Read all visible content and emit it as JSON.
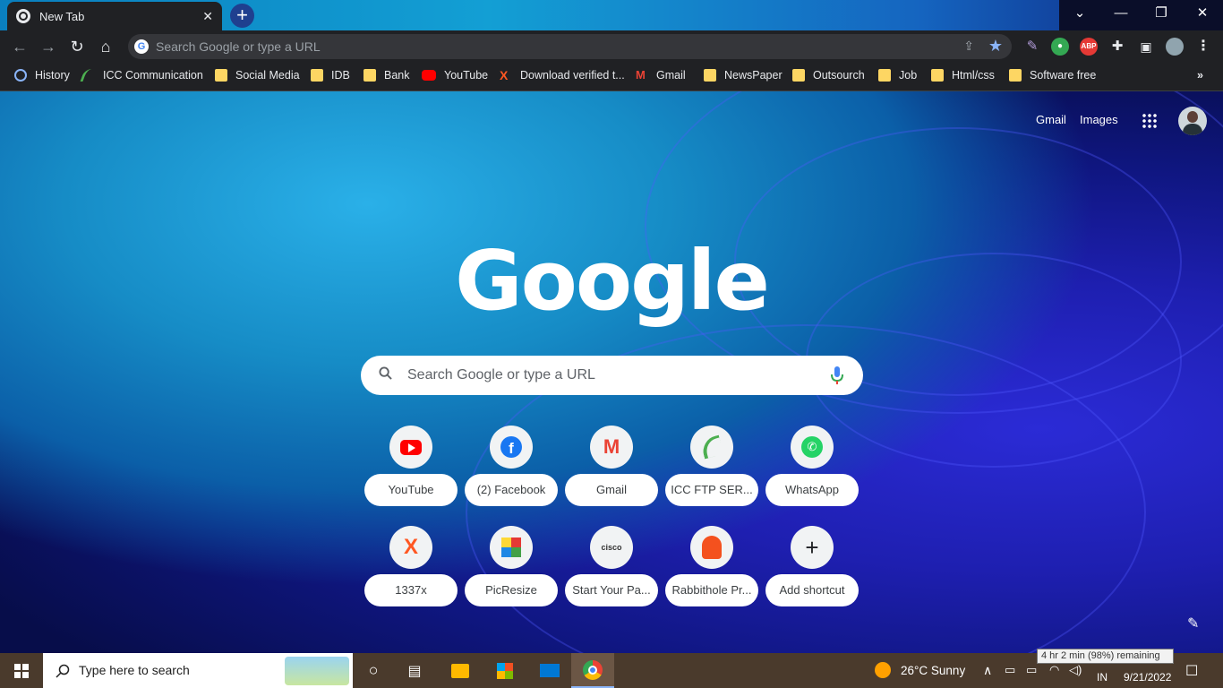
{
  "browser": {
    "tab_title": "New Tab",
    "omnibox_placeholder": "Search Google or type a URL"
  },
  "bookmarks": [
    {
      "label": "History",
      "icon": "history-icon"
    },
    {
      "label": "ICC Communication",
      "icon": "icc-icon"
    },
    {
      "label": "Social Media",
      "icon": "folder-icon"
    },
    {
      "label": "IDB",
      "icon": "folder-icon"
    },
    {
      "label": "Bank",
      "icon": "folder-icon"
    },
    {
      "label": "YouTube",
      "icon": "youtube-icon"
    },
    {
      "label": "Download verified t...",
      "icon": "x-icon"
    },
    {
      "label": "Gmail",
      "icon": "gmail-icon"
    },
    {
      "label": "NewsPaper",
      "icon": "folder-icon"
    },
    {
      "label": "Outsourch",
      "icon": "folder-icon"
    },
    {
      "label": "Job",
      "icon": "folder-icon"
    },
    {
      "label": "Html/css",
      "icon": "folder-icon"
    },
    {
      "label": "Software free",
      "icon": "folder-icon"
    }
  ],
  "ntp": {
    "gmail_link": "Gmail",
    "images_link": "Images",
    "logo_text": "Google",
    "search_placeholder": "Search Google or type a URL",
    "shortcuts": [
      {
        "label": "YouTube",
        "icon": "youtube-icon"
      },
      {
        "label": "(2) Facebook",
        "icon": "facebook-icon"
      },
      {
        "label": "Gmail",
        "icon": "gmail-icon"
      },
      {
        "label": "ICC FTP SER...",
        "icon": "icc-icon"
      },
      {
        "label": "WhatsApp",
        "icon": "whatsapp-icon"
      },
      {
        "label": "1337x",
        "icon": "x-icon"
      },
      {
        "label": "PicResize",
        "icon": "picresize-icon"
      },
      {
        "label": "Start Your Pa...",
        "icon": "cisco-icon"
      },
      {
        "label": "Rabbithole Pr...",
        "icon": "rabbithole-icon"
      },
      {
        "label": "Add shortcut",
        "icon": "plus-icon"
      }
    ]
  },
  "taskbar": {
    "search_placeholder": "Type here to search",
    "weather": "26°C  Sunny",
    "lang": "IN",
    "date": "9/21/2022",
    "battery_tooltip": "4 hr 2 min (98%) remaining"
  },
  "colors": {
    "chrome_dark": "#202124",
    "accent_blue": "#8ab4f8",
    "taskbar": "#4a3a2c"
  }
}
